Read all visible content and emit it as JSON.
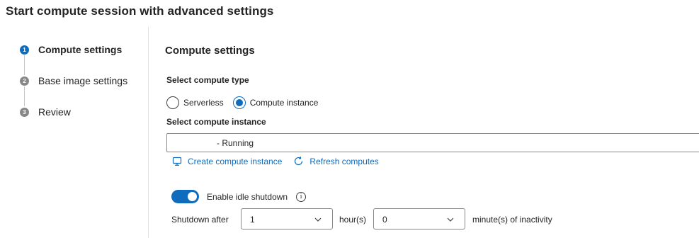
{
  "page": {
    "title": "Start compute session with advanced settings"
  },
  "steps": [
    {
      "number": "1",
      "label": "Compute settings",
      "state": "active"
    },
    {
      "number": "2",
      "label": "Base image settings",
      "state": "inactive"
    },
    {
      "number": "3",
      "label": "Review",
      "state": "inactive"
    }
  ],
  "main": {
    "section_title": "Compute settings",
    "compute_type": {
      "label": "Select compute type",
      "options": [
        {
          "label": "Serverless",
          "checked": false
        },
        {
          "label": "Compute instance",
          "checked": true
        }
      ]
    },
    "compute_instance": {
      "label": "Select compute instance",
      "value": "- Running"
    },
    "links": {
      "create": {
        "label": "Create compute instance",
        "icon": "monitor-icon"
      },
      "refresh": {
        "label": "Refresh computes",
        "icon": "refresh-icon"
      }
    },
    "idle_shutdown": {
      "enabled": true,
      "label": "Enable idle shutdown",
      "info_icon": "info-icon",
      "prefix": "Shutdown after",
      "hours_value": "1",
      "hours_unit": "hour(s)",
      "minutes_value": "0",
      "minutes_unit": "minute(s) of inactivity"
    }
  },
  "colors": {
    "accent": "#0f6cbd",
    "step_inactive": "#8a8886",
    "border": "#8a8886",
    "divider": "#e1dfdd"
  }
}
